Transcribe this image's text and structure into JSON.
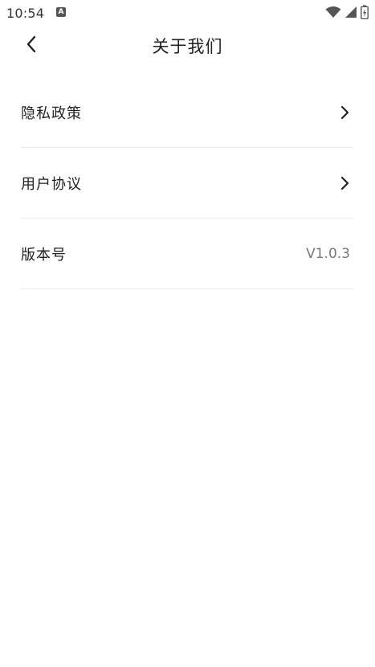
{
  "status_bar": {
    "time": "10:54",
    "notification_icon_letter": "A"
  },
  "header": {
    "title": "关于我们",
    "back_icon": "chevron-left-icon"
  },
  "menu": {
    "items": [
      {
        "label": "隐私政策",
        "icon": "chevron-right-icon"
      },
      {
        "label": "用户协议",
        "icon": "chevron-right-icon"
      },
      {
        "label": "版本号",
        "value": "V1.0.3"
      }
    ]
  },
  "colors": {
    "background": "#ffffff",
    "text_primary": "#222222",
    "text_secondary": "#777777",
    "divider": "#ececec"
  }
}
